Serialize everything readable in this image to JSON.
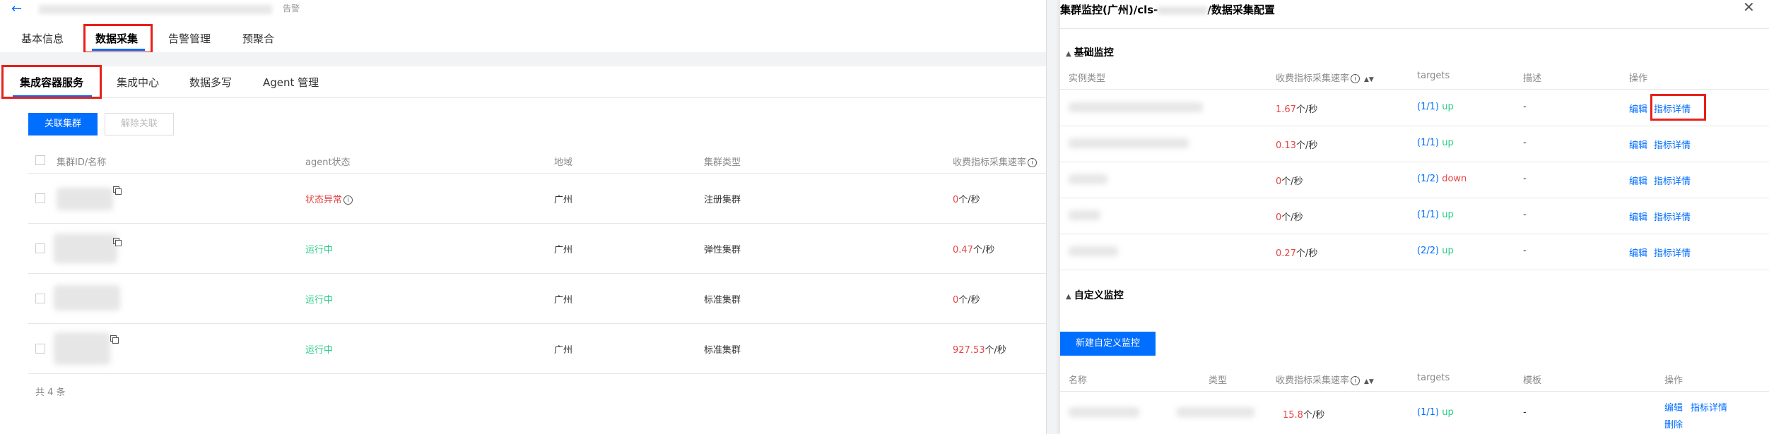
{
  "left": {
    "title_suffix": "告警",
    "main_tabs": [
      {
        "label": "基本信息"
      },
      {
        "label": "数据采集"
      },
      {
        "label": "告警管理"
      },
      {
        "label": "预聚合"
      }
    ],
    "sub_tabs": [
      {
        "label": "集成容器服务"
      },
      {
        "label": "集成中心"
      },
      {
        "label": "数据多写"
      },
      {
        "label": "Agent 管理"
      }
    ],
    "buttons": {
      "associate": "关联集群",
      "disassociate": "解除关联"
    },
    "columns": [
      "集群ID/名称",
      "agent状态",
      "地域",
      "集群类型",
      "收费指标采集速率"
    ],
    "rows": [
      {
        "status": "状态异常",
        "region": "广州",
        "type": "注册集群",
        "rate_value": "0",
        "rate_unit": "个/秒"
      },
      {
        "status": "运行中",
        "region": "广州",
        "type": "弹性集群",
        "rate_value": "0.47",
        "rate_unit": "个/秒"
      },
      {
        "status": "运行中",
        "region": "广州",
        "type": "标准集群",
        "rate_value": "0",
        "rate_unit": "个/秒"
      },
      {
        "status": "运行中",
        "region": "广州",
        "type": "标准集群",
        "rate_value": "927.53",
        "rate_unit": "个/秒"
      }
    ],
    "total": "共 4 条"
  },
  "panel": {
    "title_prefix": "集群监控(广州)/cls-",
    "title_suffix": "/数据采集配置",
    "basic": {
      "heading": "基础监控",
      "columns": [
        "实例类型",
        "收费指标采集速率",
        "targets",
        "描述",
        "操作"
      ],
      "rows": [
        {
          "rate_value": "1.67",
          "rate_unit": "个/秒",
          "targets": "(1/1)",
          "state": "up",
          "desc": "-",
          "edit": "编辑",
          "detail": "指标详情"
        },
        {
          "rate_value": "0.13",
          "rate_unit": "个/秒",
          "targets": "(1/1)",
          "state": "up",
          "desc": "-",
          "edit": "编辑",
          "detail": "指标详情"
        },
        {
          "rate_value": "0",
          "rate_unit": "个/秒",
          "targets": "(1/2)",
          "state": "down",
          "desc": "-",
          "edit": "编辑",
          "detail": "指标详情"
        },
        {
          "rate_value": "0",
          "rate_unit": "个/秒",
          "targets": "(1/1)",
          "state": "up",
          "desc": "-",
          "edit": "编辑",
          "detail": "指标详情"
        },
        {
          "rate_value": "0.27",
          "rate_unit": "个/秒",
          "targets": "(2/2)",
          "state": "up",
          "desc": "-",
          "edit": "编辑",
          "detail": "指标详情"
        }
      ]
    },
    "custom": {
      "heading": "自定义监控",
      "new_button": "新建自定义监控",
      "columns": [
        "名称",
        "类型",
        "收费指标采集速率",
        "targets",
        "模板",
        "操作"
      ],
      "rows": [
        {
          "rate_value": "15.8",
          "rate_unit": "个/秒",
          "targets": "(1/1)",
          "state": "up",
          "template": "-",
          "edit": "编辑",
          "detail": "指标详情",
          "delete": "删除"
        }
      ]
    }
  },
  "colors": {
    "accent": "#006eff",
    "danger": "#e54545",
    "success": "#29cc85",
    "highlight_box": "#e8201b"
  }
}
